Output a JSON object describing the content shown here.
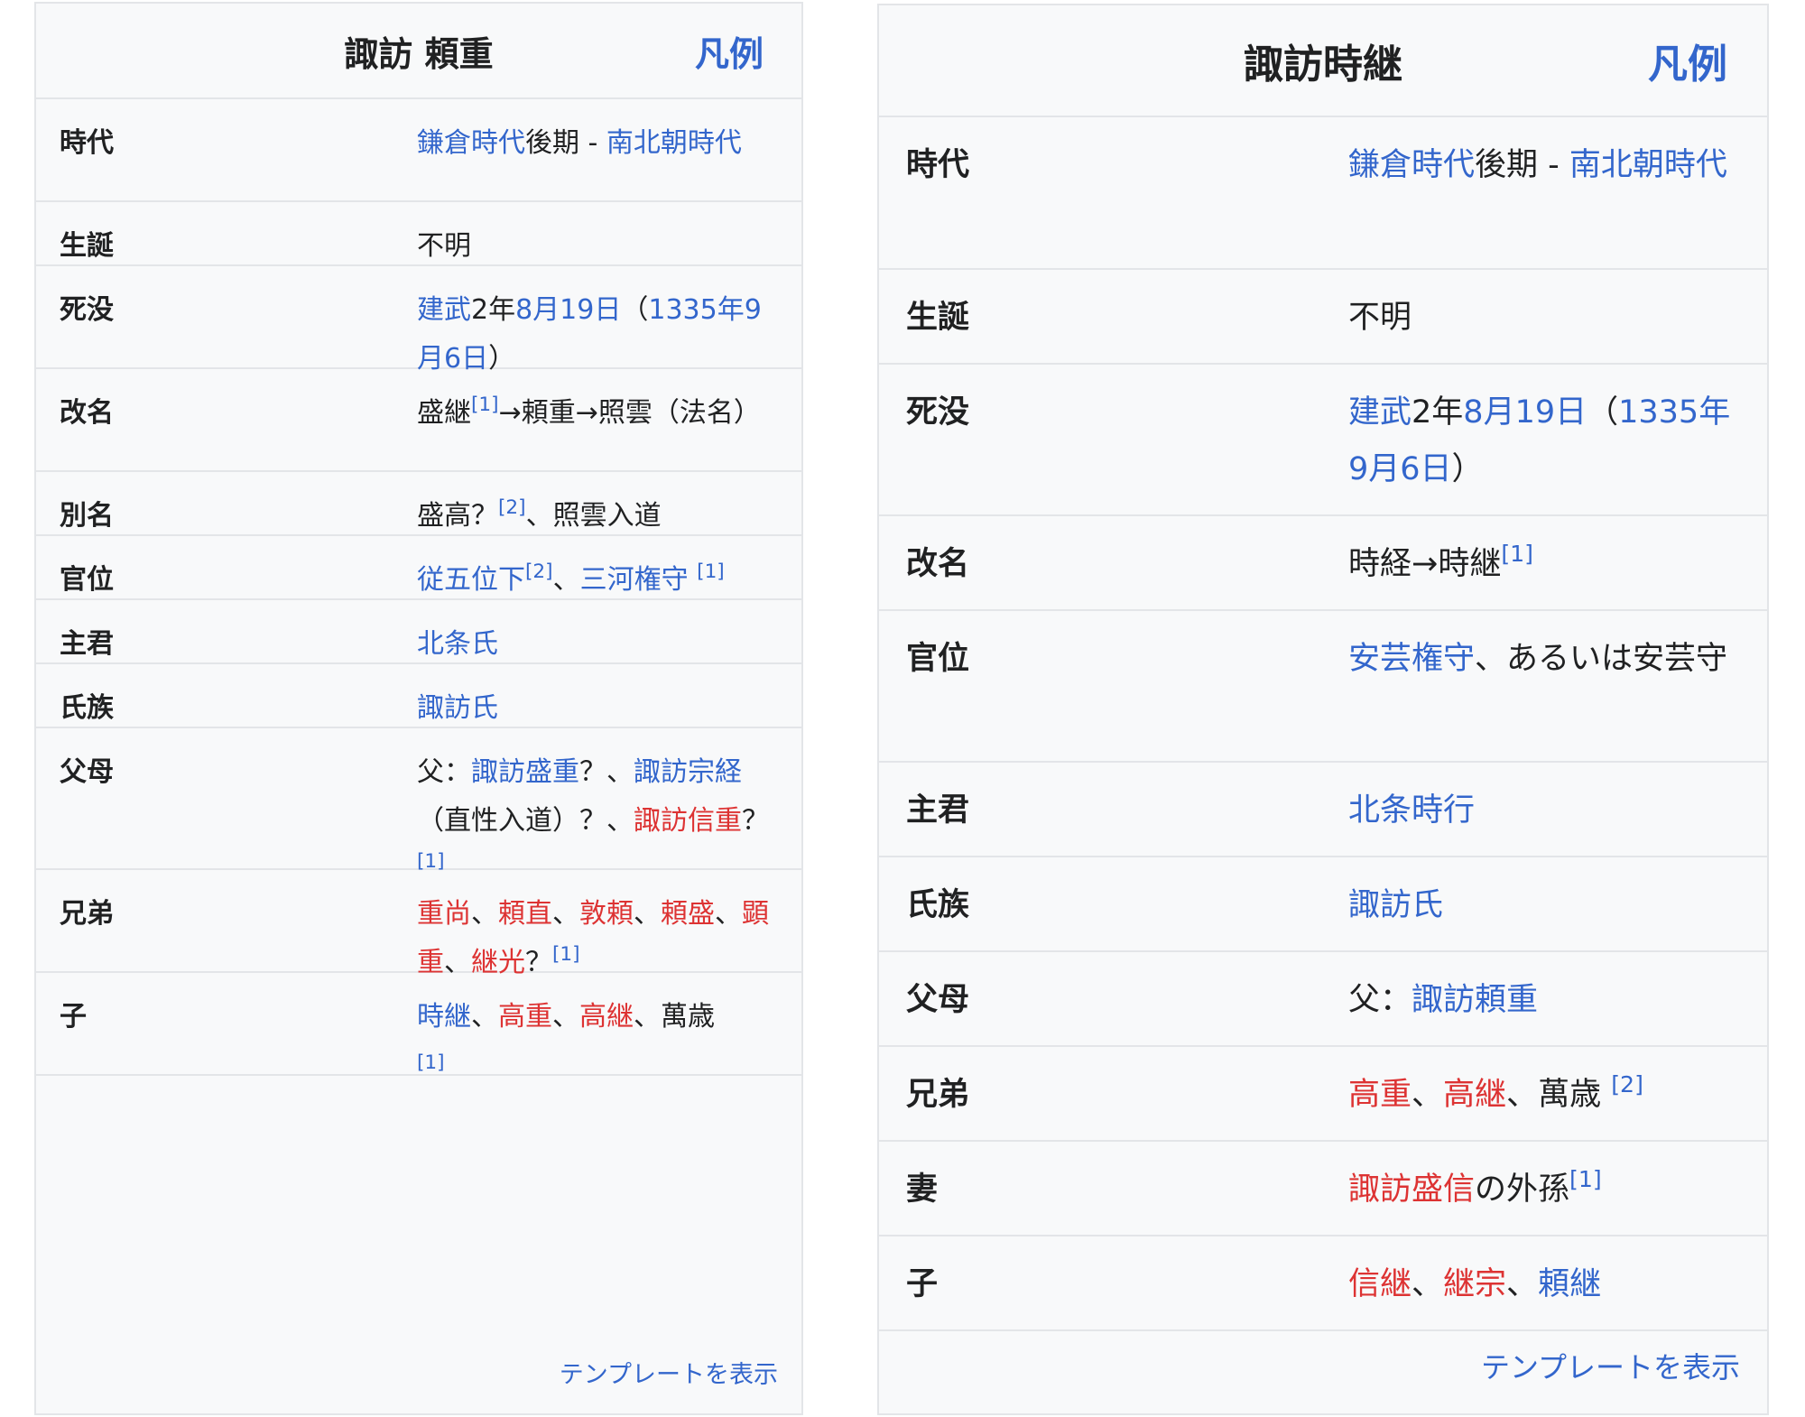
{
  "left": {
    "title": "諏訪 頼重",
    "legend": "凡例",
    "labels": {
      "era": "時代",
      "birth": "生誕",
      "death": "死没",
      "rename": "改名",
      "alias": "別名",
      "rank": "官位",
      "lord": "主君",
      "clan": "氏族",
      "parents": "父母",
      "siblings": "兄弟",
      "children": "子"
    },
    "era": {
      "link1": "鎌倉時代",
      "text1": "後期 - ",
      "link2": "南北朝時代"
    },
    "birth": "不明",
    "death": {
      "link1": "建武",
      "text1": "2年",
      "link2": "8月19日",
      "text2": "（",
      "link3": "1335年",
      "link4": "9月6日",
      "text3": "）"
    },
    "rename": {
      "text1": "盛継",
      "ref1": "[1]",
      "text2": "→頼重→照雲（法名）"
    },
    "alias": {
      "text1": "盛高？",
      "ref1": "[2]",
      "text2": "、照雲入道"
    },
    "rank": {
      "link1": "従五位下",
      "ref1": "[2]",
      "sep1": "、",
      "link2": "三河権守",
      "ref2": "[1]"
    },
    "lord": "北条氏",
    "clan": "諏訪氏",
    "parents": {
      "text1": "父：",
      "link1": "諏訪盛重",
      "text2": "？、",
      "link2": "諏訪宗経",
      "text3": "（直性入道）？、",
      "new1": "諏訪信重",
      "text4": "？",
      "ref1": "[1]"
    },
    "siblings": {
      "items": [
        "重尚",
        "頼直",
        "敦頼",
        "頼盛",
        "顕重",
        "継光"
      ],
      "sep": "、",
      "tail": "？",
      "ref1": "[1]"
    },
    "children": {
      "link1": "時継",
      "new1": "高重",
      "new2": "高継",
      "text1": "萬歳",
      "sep": "、",
      "ref1": "[1]"
    },
    "footer": "テンプレートを表示"
  },
  "right": {
    "title": "諏訪時継",
    "legend": "凡例",
    "labels": {
      "era": "時代",
      "birth": "生誕",
      "death": "死没",
      "rename": "改名",
      "rank": "官位",
      "lord": "主君",
      "clan": "氏族",
      "parents": "父母",
      "siblings": "兄弟",
      "wife": "妻",
      "children": "子"
    },
    "era": {
      "link1": "鎌倉時代",
      "text1": "後期 - ",
      "link2": "南北朝時代"
    },
    "birth": "不明",
    "death": {
      "link1": "建武",
      "text1": "2年",
      "link2": "8月19日",
      "text2": "（",
      "link3": "1335年",
      "link4": "9月6日",
      "text3": "）"
    },
    "rename": {
      "text1": "時経→時継",
      "ref1": "[1]"
    },
    "rank": {
      "link1": "安芸権守",
      "text1": "、あるいは安芸守"
    },
    "lord": "北条時行",
    "clan": "諏訪氏",
    "parents": {
      "text1": "父：",
      "link1": "諏訪頼重"
    },
    "siblings": {
      "new1": "高重",
      "new2": "高継",
      "text1": "萬歳",
      "sep": "、",
      "ref1": "[2]"
    },
    "wife": {
      "new1": "諏訪盛信",
      "text1": "の外孫",
      "ref1": "[1]"
    },
    "children": {
      "new1": "信継",
      "new2": "継宗",
      "link1": "頼継",
      "sep": "、"
    },
    "footer": "テンプレートを表示"
  }
}
